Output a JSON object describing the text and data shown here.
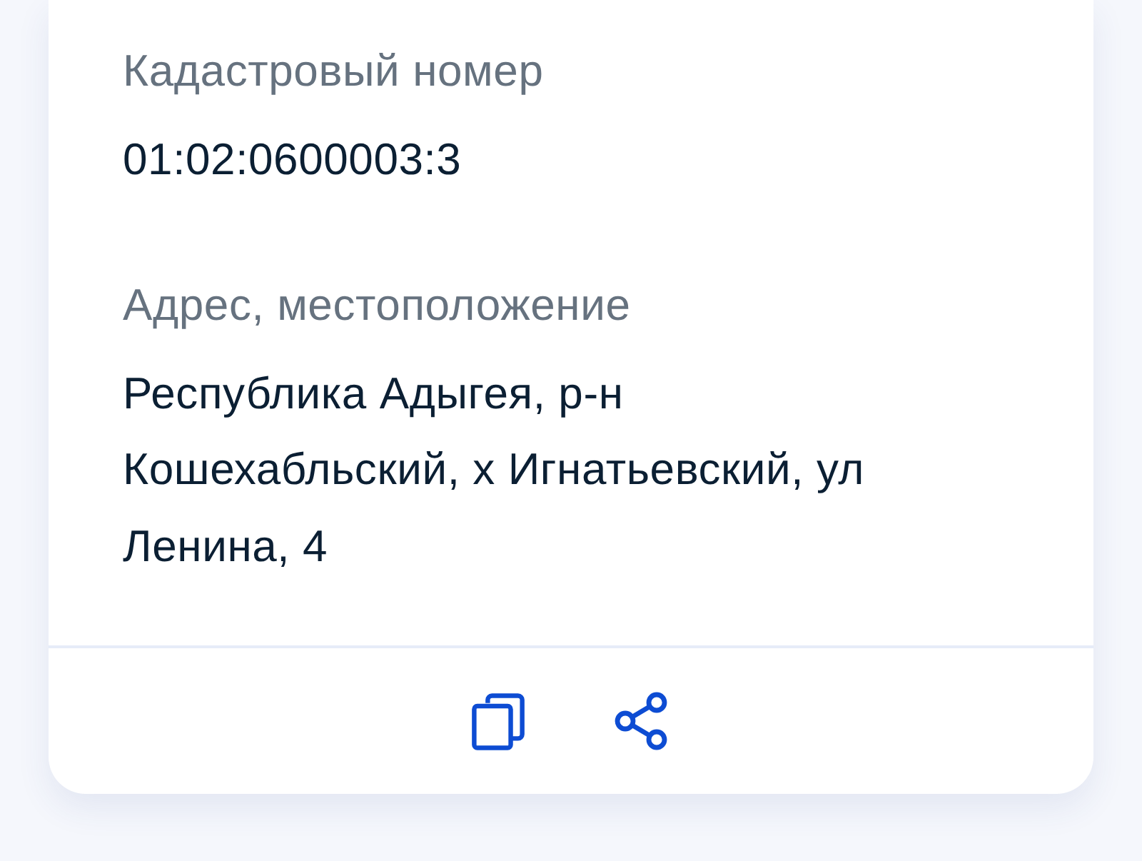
{
  "fields": [
    {
      "label": "Кадастровый номер",
      "value": "01:02:0600003:3"
    },
    {
      "label": "Адрес, местоположение",
      "value": "Республика Адыгея, р-н Кошехабльский, х Игнатьевский, ул Ленина, 4"
    }
  ],
  "actions": [
    {
      "kind": "copy"
    },
    {
      "kind": "share"
    }
  ]
}
